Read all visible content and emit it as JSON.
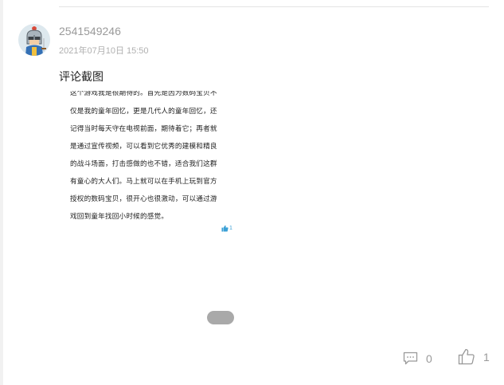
{
  "post": {
    "username": "2541549246",
    "time": "2021年07月10日 15:50",
    "title": "评论截图"
  },
  "review": {
    "lines": [
      "这个游戏我是很期待的。首先是因为数码宝贝不",
      "仅是我的童年回忆，更是几代人的童年回忆，还",
      "记得当时每天守在电视前面，期待着它；再者就",
      "是通过宣传视频，可以看到它优秀的建模和精良",
      "的战斗场面，打击感做的也不错，适合我们这群",
      "有童心的大人们。马上就可以在手机上玩到官方",
      "授权的数码宝贝，很开心也很激动，可以通过游",
      "戏回到童年找回小时候的感觉。"
    ],
    "like_count": "1"
  },
  "footer": {
    "comment_count": "0",
    "like_count": "1"
  },
  "colors": {
    "accent": "#3ba0d6",
    "muted": "#999999"
  },
  "icons": {
    "avatar": "knight-avatar",
    "comment": "comment-icon",
    "like": "thumbs-up-icon"
  }
}
